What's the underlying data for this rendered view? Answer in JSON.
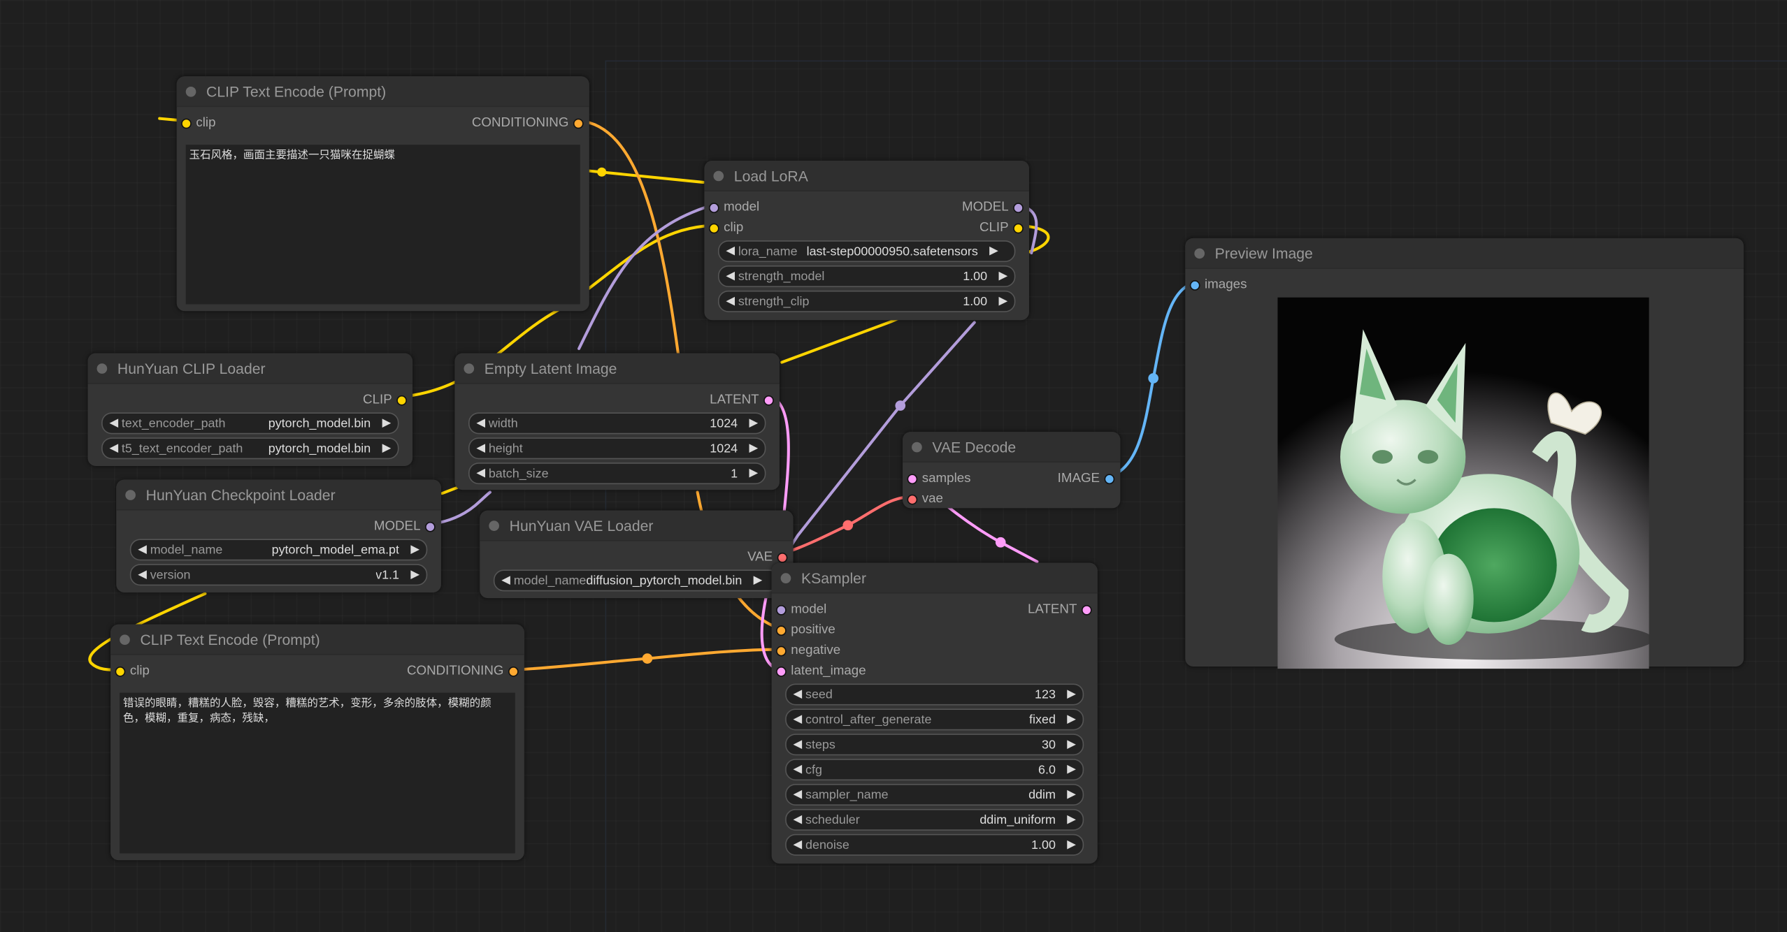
{
  "slot_colors": {
    "CLIP": "#ffd500",
    "CONDITIONING": "#ffa931",
    "MODEL": "#b39ddb",
    "LATENT": "#ff9cf9",
    "VAE": "#ff6e6e",
    "IMAGE": "#64b5f6"
  },
  "nodes": [
    {
      "title": "CLIP Text Encode (Prompt)",
      "inputs": [
        {
          "name": "clip",
          "type": "CLIP"
        }
      ],
      "outputs": [
        {
          "name": "CONDITIONING",
          "type": "CONDITIONING"
        }
      ],
      "widgets": [],
      "text": "玉石风格，画面主要描述一只猫咪在捉蝴蝶"
    },
    {
      "title": "Load LoRA",
      "inputs": [
        {
          "name": "model",
          "type": "MODEL"
        },
        {
          "name": "clip",
          "type": "CLIP"
        }
      ],
      "outputs": [
        {
          "name": "MODEL",
          "type": "MODEL"
        },
        {
          "name": "CLIP",
          "type": "CLIP"
        }
      ],
      "widgets": [
        {
          "label": "lora_name",
          "value": "last-step00000950.safetensors"
        },
        {
          "label": "strength_model",
          "value": "1.00"
        },
        {
          "label": "strength_clip",
          "value": "1.00"
        }
      ]
    },
    {
      "title": "Preview Image",
      "inputs": [
        {
          "name": "images",
          "type": "IMAGE"
        }
      ],
      "outputs": [],
      "widgets": []
    },
    {
      "title": "HunYuan CLIP Loader",
      "inputs": [],
      "outputs": [
        {
          "name": "CLIP",
          "type": "CLIP"
        }
      ],
      "widgets": [
        {
          "label": "text_encoder_path",
          "value": "pytorch_model.bin"
        },
        {
          "label": "t5_text_encoder_path",
          "value": "pytorch_model.bin"
        }
      ]
    },
    {
      "title": "Empty Latent Image",
      "inputs": [],
      "outputs": [
        {
          "name": "LATENT",
          "type": "LATENT"
        }
      ],
      "widgets": [
        {
          "label": "width",
          "value": "1024"
        },
        {
          "label": "height",
          "value": "1024"
        },
        {
          "label": "batch_size",
          "value": "1"
        }
      ]
    },
    {
      "title": "HunYuan Checkpoint Loader",
      "inputs": [],
      "outputs": [
        {
          "name": "MODEL",
          "type": "MODEL"
        }
      ],
      "widgets": [
        {
          "label": "model_name",
          "value": "pytorch_model_ema.pt"
        },
        {
          "label": "version",
          "value": "v1.1"
        }
      ]
    },
    {
      "title": "HunYuan VAE Loader",
      "inputs": [],
      "outputs": [
        {
          "name": "VAE",
          "type": "VAE"
        }
      ],
      "widgets": [
        {
          "label": "model_name",
          "value": "diffusion_pytorch_model.bin"
        }
      ]
    },
    {
      "title": "VAE Decode",
      "inputs": [
        {
          "name": "samples",
          "type": "LATENT"
        },
        {
          "name": "vae",
          "type": "VAE"
        }
      ],
      "outputs": [
        {
          "name": "IMAGE",
          "type": "IMAGE"
        }
      ],
      "widgets": []
    },
    {
      "title": "KSampler",
      "inputs": [
        {
          "name": "model",
          "type": "MODEL"
        },
        {
          "name": "positive",
          "type": "CONDITIONING"
        },
        {
          "name": "negative",
          "type": "CONDITIONING"
        },
        {
          "name": "latent_image",
          "type": "LATENT"
        }
      ],
      "outputs": [
        {
          "name": "LATENT",
          "type": "LATENT"
        }
      ],
      "widgets": [
        {
          "label": "seed",
          "value": "123"
        },
        {
          "label": "control_after_generate",
          "value": "fixed"
        },
        {
          "label": "steps",
          "value": "30"
        },
        {
          "label": "cfg",
          "value": "6.0"
        },
        {
          "label": "sampler_name",
          "value": "ddim"
        },
        {
          "label": "scheduler",
          "value": "ddim_uniform"
        },
        {
          "label": "denoise",
          "value": "1.00"
        }
      ]
    },
    {
      "title": "CLIP Text Encode (Prompt)",
      "inputs": [
        {
          "name": "clip",
          "type": "CLIP"
        }
      ],
      "outputs": [
        {
          "name": "CONDITIONING",
          "type": "CONDITIONING"
        }
      ],
      "widgets": [],
      "text": "错误的眼睛，糟糕的人脸，毁容，糟糕的艺术，变形，多余的肢体，模糊的颜色，模糊，重复，病态，残缺，"
    }
  ]
}
